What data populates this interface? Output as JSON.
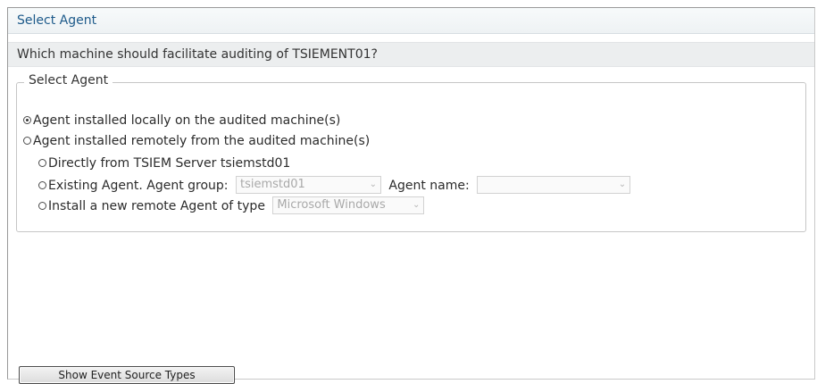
{
  "header": {
    "title": "Select Agent"
  },
  "question": "Which machine should facilitate auditing of TSIEMENT01?",
  "fieldset": {
    "legend": "Select Agent",
    "option_local": "Agent installed locally on the audited machine(s)",
    "option_remote": "Agent installed remotely from the audited machine(s)",
    "sub_direct": "Directly from TSIEM Server tsiemstd01",
    "sub_existing": "Existing Agent. Agent group:",
    "agent_group_value": "tsiemstd01",
    "agent_name_label": "Agent name:",
    "agent_name_value": "",
    "sub_install": "Install a new remote Agent of type",
    "agent_type_value": "Microsoft Windows"
  },
  "actions": {
    "show_event_source_types": "Show Event Source Types"
  },
  "icons": {
    "dropdown_arrow": "chevron-down-icon"
  },
  "colors": {
    "title": "#1d5a8a",
    "question_bg": "#eceeef"
  }
}
